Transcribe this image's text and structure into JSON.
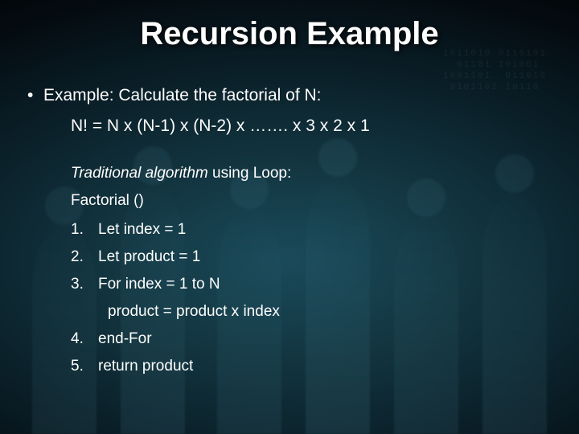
{
  "title": "Recursion Example",
  "bullet": {
    "dot": "•",
    "text": "Example: Calculate the factorial of N:"
  },
  "formula": "N! = N x (N-1) x (N-2) x ……. x 3 x 2 x 1",
  "subhead": {
    "ital": "Traditional algorithm",
    "rest": " using Loop:"
  },
  "fn": "Factorial ()",
  "steps": [
    {
      "num": "1.",
      "text": "Let index = 1"
    },
    {
      "num": "2.",
      "text": "Let  product = 1"
    },
    {
      "num": "3.",
      "text": "For index = 1 to N"
    }
  ],
  "indent": "product = product x index",
  "steps2": [
    {
      "num": "4.",
      "text": "end-For"
    },
    {
      "num": "5.",
      "text": "return product"
    }
  ],
  "bg_digits": "1011010 0110101\n  01101 101001\n1001101  011010\n 0101101 10110"
}
